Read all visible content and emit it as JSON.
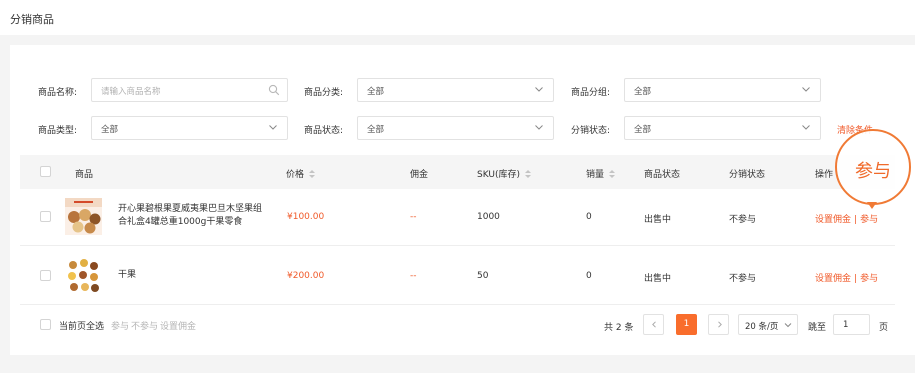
{
  "page": {
    "title": "分销商品"
  },
  "filters": {
    "name_label": "商品名称:",
    "name_placeholder": "请输入商品名称",
    "category_label": "商品分类:",
    "category_value": "全部",
    "group_label": "商品分组:",
    "group_value": "全部",
    "type_label": "商品类型:",
    "type_value": "全部",
    "status_label": "商品状态:",
    "status_value": "全部",
    "dist_status_label": "分销状态:",
    "dist_status_value": "全部",
    "clear_label": "清除条件"
  },
  "table": {
    "columns": [
      "商品",
      "价格",
      "佣金",
      "SKU(库存)",
      "销量",
      "商品状态",
      "分销状态",
      "操作"
    ],
    "rows": [
      {
        "name": "开心果碧根果夏威夷果巴旦木坚果组合礼盒4罐总重1000g干果零食",
        "price": "¥100.00",
        "commission": "--",
        "sku": "1000",
        "sales": "0",
        "status": "出售中",
        "dist_status": "不参与",
        "op_set": "设置佣金",
        "op_sep": "|",
        "op_join": "参与"
      },
      {
        "name": "干果",
        "price": "¥200.00",
        "commission": "--",
        "sku": "50",
        "sales": "0",
        "status": "出售中",
        "dist_status": "不参与",
        "op_set": "设置佣金",
        "op_sep": "|",
        "op_join": "参与"
      }
    ]
  },
  "footer": {
    "select_all_label": "当前页全选",
    "batch_join": "参与",
    "batch_not_join": "不参与",
    "batch_set_commission": "设置佣金"
  },
  "pagination": {
    "total": "共 2 条",
    "current_page": "1",
    "page_size": "20 条/页",
    "jump_label": "跳至",
    "jump_value": "1",
    "page_suffix": "页"
  },
  "callout": {
    "text": "参与"
  },
  "colors": {
    "accent": "#f05a2a",
    "active_page": "#f96d2c"
  }
}
